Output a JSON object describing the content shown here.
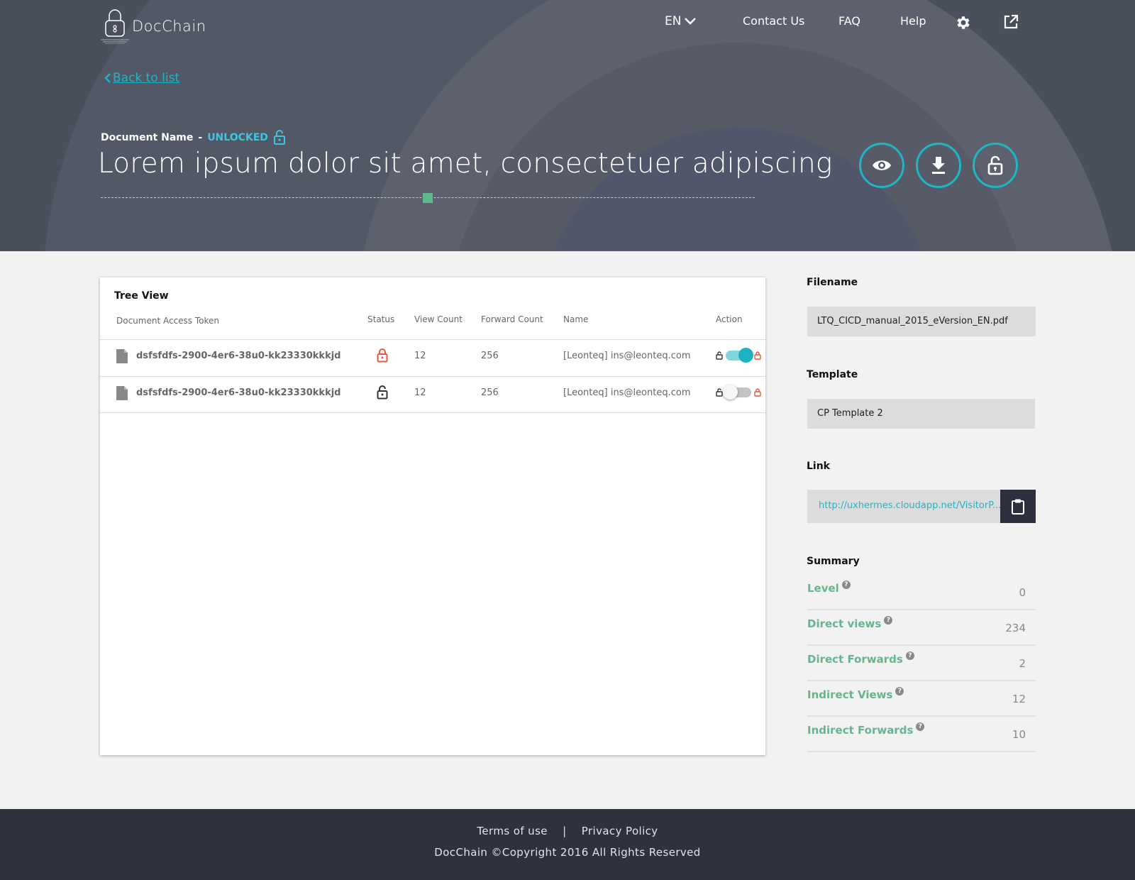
{
  "app": {
    "name": "DocChain"
  },
  "nav": {
    "language": "EN",
    "contact": "Contact Us",
    "faq": "FAQ",
    "help": "Help"
  },
  "back_link": "Back to list",
  "document": {
    "name_label": "Document Name",
    "separator": "-",
    "status": "UNLOCKED",
    "title": "Lorem ipsum dolor sit amet, consectetuer adipiscing"
  },
  "tree": {
    "title": "Tree View",
    "headers": {
      "token": "Document Access Token",
      "status": "Status",
      "views": "View Count",
      "forwards": "Forward Count",
      "name": "Name",
      "action": "Action"
    },
    "rows": [
      {
        "token": "dsfsfdfs-2900-4er6-38u0-kk23330kkkjd",
        "status": "locked-red",
        "views": "12",
        "forwards": "256",
        "name": "[Leonteq] ins@leonteq.com",
        "toggle": "on"
      },
      {
        "token": "dsfsfdfs-2900-4er6-38u0-kk23330kkkjd",
        "status": "unlocked-dark",
        "views": "12",
        "forwards": "256",
        "name": "[Leonteq] ins@leonteq.com",
        "toggle": "off"
      }
    ]
  },
  "side": {
    "filename_label": "Filename",
    "filename": "LTQ_CICD_manual_2015_eVersion_EN.pdf",
    "template_label": "Template",
    "template": "CP Template 2",
    "link_label": "Link",
    "link": "http://uxhermes.cloudapp.net/VisitorP....",
    "summary_label": "Summary",
    "summary": [
      {
        "label": "Level",
        "value": "0"
      },
      {
        "label": "Direct views",
        "value": "234"
      },
      {
        "label": "Direct Forwards",
        "value": "2"
      },
      {
        "label": "Indirect Views",
        "value": "12"
      },
      {
        "label": "Indirect Forwards",
        "value": "10"
      }
    ]
  },
  "footer": {
    "terms": "Terms of use",
    "divider": "|",
    "privacy": "Privacy Policy",
    "copyright": "DocChain  ©Copyright 2016 All Rights Reserved"
  },
  "colors": {
    "accent": "#20b5c5",
    "hero_bg": "#4a4f5c",
    "summary_label": "#66b58f",
    "lock_red": "#e9573f",
    "footer_bg": "#2f323d"
  }
}
